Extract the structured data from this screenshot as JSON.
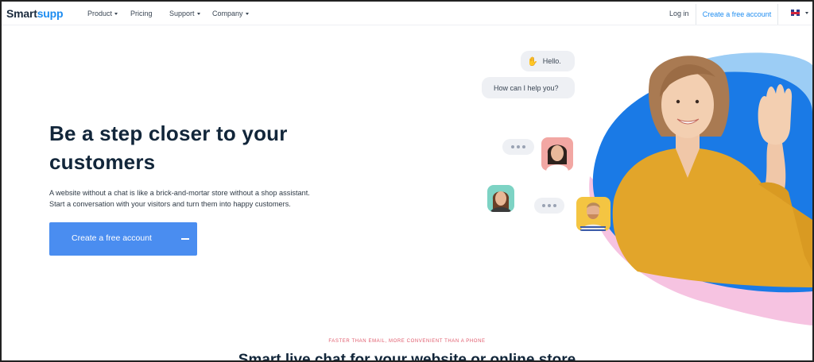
{
  "nav": {
    "logo_part1": "Smart",
    "logo_part2": "supp",
    "product": "Product",
    "pricing": "Pricing",
    "support": "Support",
    "company": "Company",
    "login": "Log in",
    "cta": "Create a free account",
    "language_icon": "uk-flag-icon"
  },
  "hero": {
    "headline": "Be a step closer to your customers",
    "sub_line1": "A website without a chat is like a brick-and-mortar store without a shop assistant.",
    "sub_line2": "Start a conversation with your visitors and turn them into happy customers.",
    "cta": "Create a free account"
  },
  "chat": {
    "hello": "Hello.",
    "help": "How can I help you?"
  },
  "bottom": {
    "tagline": "FASTER THAN EMAIL, MORE CONVENIENT THAN A PHONE",
    "title": "Smart live chat for your website or online store"
  },
  "colors": {
    "accent": "#1d8cf0",
    "button": "#4a8df0",
    "blob_blue": "#1a7ae6",
    "blob_pink": "#f6c3e1",
    "sweater": "#e2a52a"
  }
}
